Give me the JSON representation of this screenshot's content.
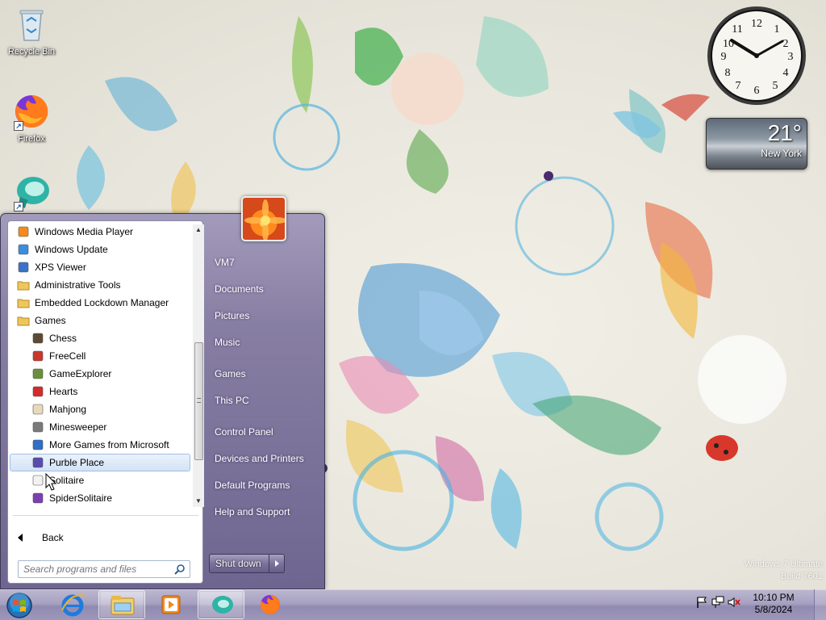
{
  "desktop": {
    "icons": [
      {
        "label": "Recycle Bin",
        "icon": "recycle-bin-icon"
      },
      {
        "label": "Firefox",
        "icon": "firefox-icon"
      },
      {
        "label": "",
        "icon": "app-shortcut-icon"
      }
    ],
    "weather": {
      "temperature": "21°",
      "city": "New York"
    },
    "watermark": {
      "line1": "Windows 7 Ultimate",
      "line2": "Build 7601"
    }
  },
  "start_menu": {
    "programs": [
      {
        "label": "Windows Media Player",
        "icon": "media-player-icon",
        "indent": false,
        "selected": false
      },
      {
        "label": "Windows Update",
        "icon": "windows-update-icon",
        "indent": false,
        "selected": false
      },
      {
        "label": "XPS Viewer",
        "icon": "xps-viewer-icon",
        "indent": false,
        "selected": false
      },
      {
        "label": "Administrative Tools",
        "icon": "folder-icon",
        "indent": false,
        "selected": false
      },
      {
        "label": "Embedded Lockdown Manager",
        "icon": "folder-icon",
        "indent": false,
        "selected": false
      },
      {
        "label": "Games",
        "icon": "folder-icon",
        "indent": false,
        "selected": false
      },
      {
        "label": "Chess",
        "icon": "chess-icon",
        "indent": true,
        "selected": false
      },
      {
        "label": "FreeCell",
        "icon": "freecell-icon",
        "indent": true,
        "selected": false
      },
      {
        "label": "GameExplorer",
        "icon": "game-explorer-icon",
        "indent": true,
        "selected": false
      },
      {
        "label": "Hearts",
        "icon": "hearts-icon",
        "indent": true,
        "selected": false
      },
      {
        "label": "Mahjong",
        "icon": "mahjong-icon",
        "indent": true,
        "selected": false
      },
      {
        "label": "Minesweeper",
        "icon": "minesweeper-icon",
        "indent": true,
        "selected": false
      },
      {
        "label": "More Games from Microsoft",
        "icon": "more-games-icon",
        "indent": true,
        "selected": false
      },
      {
        "label": "Purble Place",
        "icon": "purble-place-icon",
        "indent": true,
        "selected": true
      },
      {
        "label": "Solitaire",
        "icon": "solitaire-icon",
        "indent": true,
        "selected": false
      },
      {
        "label": "SpiderSolitaire",
        "icon": "spider-solitaire-icon",
        "indent": true,
        "selected": false
      }
    ],
    "back_label": "Back",
    "search_placeholder": "Search programs and files",
    "right_items": {
      "user": "VM7",
      "documents": "Documents",
      "pictures": "Pictures",
      "music": "Music",
      "games": "Games",
      "this_pc": "This PC",
      "control_panel": "Control Panel",
      "devices": "Devices and Printers",
      "default_programs": "Default Programs",
      "help": "Help and Support"
    },
    "shutdown_label": "Shut down"
  },
  "taskbar": {
    "pinned": [
      {
        "icon": "internet-explorer-icon",
        "active": false
      },
      {
        "icon": "file-explorer-icon",
        "active": true
      },
      {
        "icon": "media-player-icon",
        "active": false
      },
      {
        "icon": "app-shortcut-icon",
        "active": true
      },
      {
        "icon": "firefox-icon",
        "active": false
      }
    ],
    "tray_icons": [
      "action-center-flag-icon",
      "network-icon",
      "volume-muted-icon"
    ],
    "time": "10:10 PM",
    "date": "5/8/2024"
  },
  "colors": {
    "start_menu_glass": "#877ea3",
    "selected_item": "#d3e3f6",
    "taskbar": "#a7a1c1"
  }
}
